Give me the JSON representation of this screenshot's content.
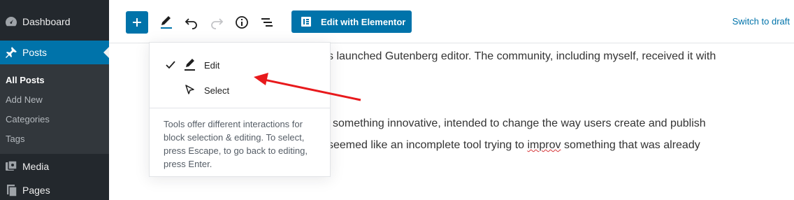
{
  "sidebar": {
    "items": [
      {
        "label": "Dashboard",
        "icon": "dashboard-icon"
      },
      {
        "label": "Posts",
        "icon": "pushpin-icon",
        "active": true
      },
      {
        "label": "Media",
        "icon": "media-icon"
      },
      {
        "label": "Pages",
        "icon": "pages-icon"
      }
    ],
    "submenu": [
      "All Posts",
      "Add New",
      "Categories",
      "Tags"
    ]
  },
  "toolbar": {
    "add_icon": "plus-icon",
    "tools_icon": "pencil-icon",
    "undo_icon": "undo-icon",
    "redo_icon": "redo-icon",
    "info_icon": "info-icon",
    "outline_icon": "list-view-icon",
    "elementor_label": "Edit with Elementor",
    "switch_draft": "Switch to draft"
  },
  "content": {
    "line1": "s launched Gutenberg editor. The community, including myself, received it with",
    "line2": " something innovative, intended to change the way users create and publish",
    "line3_a": "seemed like an incomplete tool trying to ",
    "line3_misspelled": "improv",
    "line3_b": " something that was already"
  },
  "tools_menu": {
    "items": [
      {
        "label": "Edit",
        "icon": "pencil-icon",
        "checked": true
      },
      {
        "label": "Select",
        "icon": "cursor-icon",
        "checked": false
      }
    ],
    "description": "Tools offer different interactions for block selection & editing. To select, press Escape, to go back to editing, press Enter."
  },
  "colors": {
    "sidebar_bg": "#23282d",
    "accent": "#0073aa",
    "annotation_arrow": "#e8191c"
  }
}
